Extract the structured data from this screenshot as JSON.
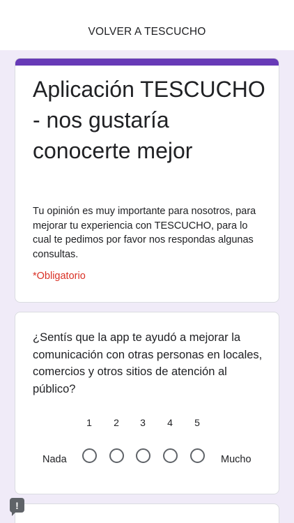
{
  "topbar": {
    "link_label": "VOLVER A TESCUCHO"
  },
  "form": {
    "title": "Aplicación TESCUCHO - nos gustaría conocerte mejor",
    "description": "Tu opinión es muy importante para nosotros, para mejorar tu experiencia con TESCUCHO, para lo cual te pedimos por favor nos respondas algunas consultas.",
    "required_note": "*Obligatorio",
    "accent_color": "#673ab7",
    "required_color": "#d93025"
  },
  "question1": {
    "text": "¿Sentís que la app te ayudó a mejorar la comunicación con otras personas en locales, comercios y otros sitios de atención al público?",
    "scale_numbers": [
      "1",
      "2",
      "3",
      "4",
      "5"
    ],
    "low_label": "Nada",
    "high_label": "Mucho"
  },
  "icons": {
    "report": "report-problem-icon"
  }
}
